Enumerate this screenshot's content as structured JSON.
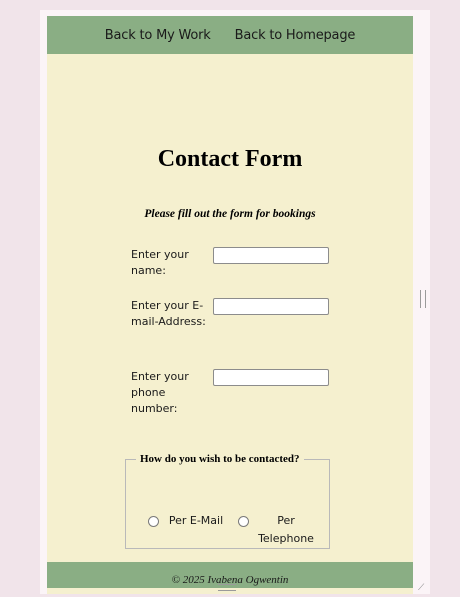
{
  "nav": {
    "links": [
      {
        "label": "Back to My Work"
      },
      {
        "label": "Back to Homepage"
      }
    ]
  },
  "form": {
    "title": "Contact Form",
    "subtitle": "Please fill out the form for bookings",
    "fields": [
      {
        "label": "Enter your name:",
        "value": "",
        "placeholder": ""
      },
      {
        "label": "Enter your E-mail-Address:",
        "value": "",
        "placeholder": ""
      },
      {
        "label": "Enter your phone number:",
        "value": "",
        "placeholder": ""
      }
    ],
    "contact_method": {
      "legend": "How do you wish to be contacted?",
      "options": [
        {
          "label": "Per E-Mail",
          "selected": false
        },
        {
          "label": "Per Telephone",
          "selected": false
        }
      ]
    }
  },
  "footer": {
    "text": "© 2025 Ivabena Ogwentin"
  }
}
